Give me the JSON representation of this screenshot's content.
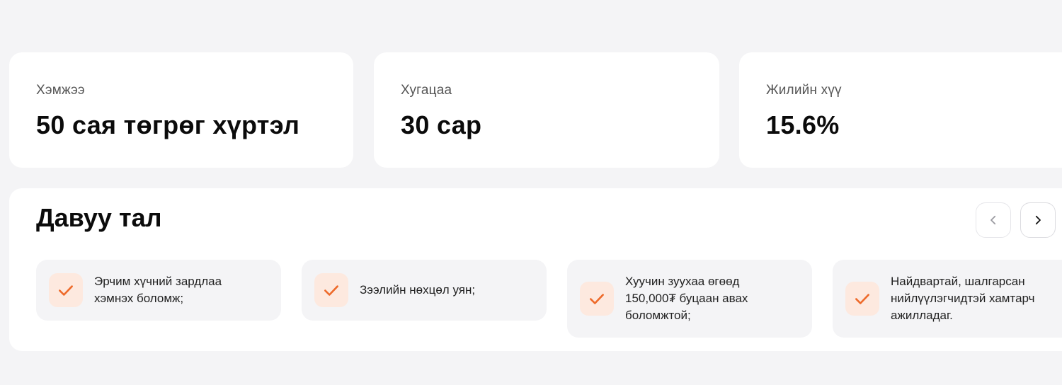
{
  "stats": [
    {
      "label": "Хэмжээ",
      "value": "50 сая төгрөг хүртэл"
    },
    {
      "label": "Хугацаа",
      "value": "30 сар"
    },
    {
      "label": "Жилийн хүү",
      "value": "15.6%"
    }
  ],
  "advantages": {
    "title": "Давуу тал",
    "items": [
      {
        "text": "Эрчим хүчний зардлаа хэмнэх боломж;"
      },
      {
        "text": "Зээлийн нөхцөл уян;"
      },
      {
        "text": "Хуучин зуухаа өгөөд 150,000₮ буцаан авах боломжтой;"
      },
      {
        "text": "Найдвартай, шалгарсан нийлүүлэгчидтэй хамтарч ажилладаг."
      }
    ]
  },
  "icons": {
    "check": "check-icon",
    "prev": "chevron-left-icon",
    "next": "chevron-right-icon"
  },
  "colors": {
    "accent": "#ee6a2a",
    "accent_soft": "#fde9df",
    "background": "#f4f4f6",
    "card": "#ffffff"
  }
}
